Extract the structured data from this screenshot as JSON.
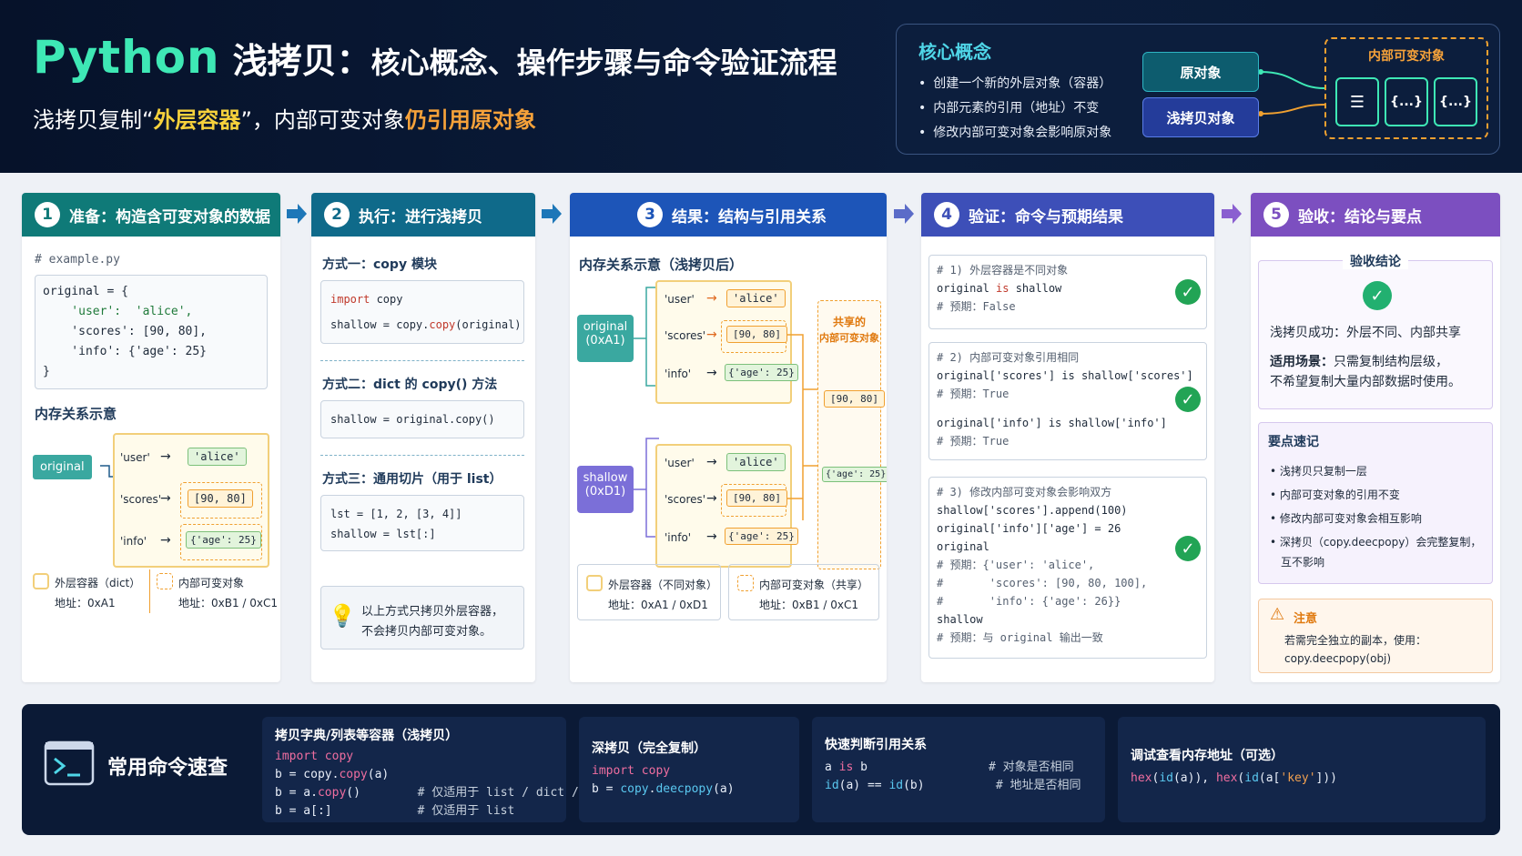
{
  "header": {
    "title_python": "Python",
    "title_main": "浅拷贝：",
    "title_rest": "核心概念、操作步骤与命令验证流程",
    "subtitle_a": "浅拷贝复制“",
    "subtitle_b": "外层容器",
    "subtitle_c": "”，内部可变对象",
    "subtitle_d": "仍引用原对象"
  },
  "concept": {
    "title": "核心概念",
    "items": [
      "创建一个新的外层对象（容器）",
      "内部元素的引用（地址）不变",
      "修改内部可变对象会影响原对象"
    ],
    "original_label": "原对象",
    "shallow_label": "浅拷贝对象",
    "inner_label": "内部可变对象",
    "icons": [
      "☰",
      "{...}",
      "{...}"
    ]
  },
  "panels": [
    {
      "num": "1",
      "title": "准备：构造含可变对象的数据",
      "color": "#0f7a78"
    },
    {
      "num": "2",
      "title": "执行：进行浅拷贝",
      "color": "#0f6a8a"
    },
    {
      "num": "3",
      "title": "结果：结构与引用关系",
      "color": "#1d55b8"
    },
    {
      "num": "4",
      "title": "验证：命令与预期结果",
      "color": "#3d4fb8"
    },
    {
      "num": "5",
      "title": "验收：结论与要点",
      "color": "#7c4fc0"
    }
  ],
  "p1": {
    "file_comment": "# example.py",
    "code": [
      "original = {",
      "    'user':  'alice',",
      "    'scores': [90, 80],",
      "    'info': {'age': 25}",
      "}"
    ],
    "mem_title": "内存关系示意",
    "original_label": "original",
    "keys": [
      "'user'",
      "'scores'",
      "'info'"
    ],
    "vals": [
      "'alice'",
      "[90, 80]",
      "{'age': 25}"
    ],
    "legend_outer": "外层容器（dict）",
    "legend_outer_addr": "地址：0xA1",
    "legend_inner": "内部可变对象",
    "legend_inner_addr": "地址：0xB1 / 0xC1"
  },
  "p2": {
    "m1_title": "方式一：copy 模块",
    "m1_code_a": "import",
    "m1_code_b": " copy",
    "m1_code_c": "shallow = copy.",
    "m1_code_d": "copy",
    "m1_code_e": "(original)",
    "m2_title": "方式二：dict 的 copy() 方法",
    "m2_code": "shallow = original.copy()",
    "m3_title": "方式三：通用切片（用于 list）",
    "m3_code_1": "lst = [1, 2, [3, 4]]",
    "m3_code_2": "shallow = lst[:]",
    "note_1": "以上方式只拷贝外层容器，",
    "note_2": "不会拷贝内部可变对象。"
  },
  "p3": {
    "title": "内存关系示意（浅拷贝后）",
    "original_label_1": "original",
    "original_label_2": "(0xA1)",
    "shallow_label_1": "shallow",
    "shallow_label_2": "(0xD1)",
    "keys": [
      "'user'",
      "'scores'",
      "'info'"
    ],
    "vals": [
      "'alice'",
      "[90, 80]",
      "{'age': 25}"
    ],
    "shared_title_1": "共享的",
    "shared_title_2": "内部可变对象",
    "shared_list": "[90, 80]",
    "shared_dict": "{'age': 25}",
    "legend_outer": "外层容器（不同对象）",
    "legend_outer_addr": "地址：0xA1 / 0xD1",
    "legend_inner": "内部可变对象（共享）",
    "legend_inner_addr": "地址：0xB1 / 0xC1"
  },
  "p4": {
    "b1_c1": "# 1) 外层容器是不同对象",
    "b1_l1a": "original ",
    "b1_l1b": "is",
    "b1_l1c": " shallow",
    "b1_c2": "# 预期：False",
    "b2_c1": "# 2) 内部可变对象引用相同",
    "b2_l1": "original['scores'] is shallow['scores']",
    "b2_c2": "# 预期：True",
    "b2_l2": "original['info'] is shallow['info']",
    "b2_c3": "# 预期：True",
    "b3_c1": "# 3) 修改内部可变对象会影响双方",
    "b3_l1": "shallow['scores'].append(100)",
    "b3_l2": "original['info']['age'] = 26",
    "b3_l3": "original",
    "b3_l4": "# 预期：{'user': 'alice',",
    "b3_l5": "#       'scores': [90, 80, 100],",
    "b3_l6": "#       'info': {'age': 26}}",
    "b3_l7": "shallow",
    "b3_l8": "# 预期：与 original 输出一致"
  },
  "p5": {
    "conclusion_title": "验收结论",
    "result": "浅拷贝成功：外层不同、内部共享",
    "scene_a": "适用场景：",
    "scene_b": "只需复制结构层级，",
    "scene_c": "不希望复制大量内部数据时使用。",
    "tips_title": "要点速记",
    "tips": [
      "浅拷贝只复制一层",
      "内部可变对象的引用不变",
      "修改内部可变对象会相互影响",
      "深拷贝（copy.deecpopy）会完整复制，",
      "互不影响"
    ],
    "warn_title": "注意",
    "warn_1": "若需完全独立的副本，使用：",
    "warn_2": "copy.deecpopy(obj)"
  },
  "bottom": {
    "title": "常用命令速查",
    "c1_title": "拷贝字典/列表等容器（浅拷贝）",
    "c2_title": "深拷贝（完全复制）",
    "c3_title": "快速判断引用关系",
    "c4_title": "调试查看内存地址（可选）"
  },
  "colors": {
    "accent": "#3ee8b5",
    "header_bg": "#06122a",
    "orange": "#f6a23a",
    "green_check": "#22a455"
  }
}
